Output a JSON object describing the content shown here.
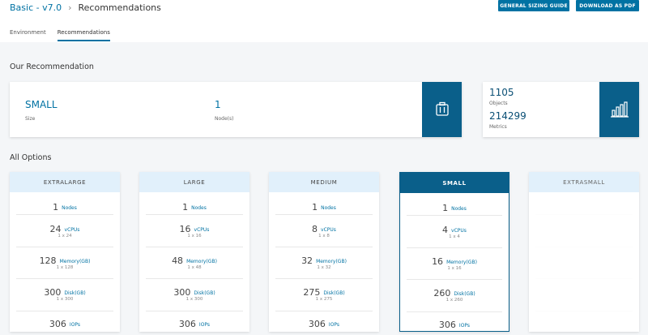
{
  "header": {
    "breadcrumb_root": "Basic - v7.0",
    "breadcrumb_separator": "›",
    "breadcrumb_current": "Recommendations",
    "sizing_guide_button": "GENERAL SIZING GUIDE",
    "download_pdf_button": "DOWNLOAD AS PDF",
    "tabs": [
      {
        "label": "Environment"
      },
      {
        "label": "Recommendations"
      }
    ],
    "active_tab": "Recommendations"
  },
  "recommendation": {
    "title": "Our Recommendation",
    "size_value": "SMALL",
    "size_label": "Size",
    "nodes_value": "1",
    "nodes_label": "Node(s)",
    "icon": "cluster-icon",
    "objects_value": "1105",
    "objects_label": "Objects",
    "metrics_value": "214299",
    "metrics_label": "Metrics",
    "stats_icon": "bar-chart-icon"
  },
  "options": {
    "title": "All Options",
    "selected": "SMALL",
    "cards": [
      {
        "name": "EXTRALARGE",
        "nodes": {
          "value": "1",
          "unit": "Nodes"
        },
        "vcpus": {
          "value": "24",
          "unit": "vCPUs",
          "detail": "1 x 24"
        },
        "memory": {
          "value": "128",
          "unit": "Memory(GB)",
          "detail": "1 x 128"
        },
        "disk": {
          "value": "300",
          "unit": "Disk(GB)",
          "detail": "1 x 300"
        },
        "iops": {
          "value": "306",
          "unit": "IOPs"
        }
      },
      {
        "name": "LARGE",
        "nodes": {
          "value": "1",
          "unit": "Nodes"
        },
        "vcpus": {
          "value": "16",
          "unit": "vCPUs",
          "detail": "1 x 16"
        },
        "memory": {
          "value": "48",
          "unit": "Memory(GB)",
          "detail": "1 x 48"
        },
        "disk": {
          "value": "300",
          "unit": "Disk(GB)",
          "detail": "1 x 300"
        },
        "iops": {
          "value": "306",
          "unit": "IOPs"
        }
      },
      {
        "name": "MEDIUM",
        "nodes": {
          "value": "1",
          "unit": "Nodes"
        },
        "vcpus": {
          "value": "8",
          "unit": "vCPUs",
          "detail": "1 x 8"
        },
        "memory": {
          "value": "32",
          "unit": "Memory(GB)",
          "detail": "1 x 32"
        },
        "disk": {
          "value": "275",
          "unit": "Disk(GB)",
          "detail": "1 x 275"
        },
        "iops": {
          "value": "306",
          "unit": "IOPs"
        }
      },
      {
        "name": "SMALL",
        "nodes": {
          "value": "1",
          "unit": "Nodes"
        },
        "vcpus": {
          "value": "4",
          "unit": "vCPUs",
          "detail": "1 x 4"
        },
        "memory": {
          "value": "16",
          "unit": "Memory(GB)",
          "detail": "1 x 16"
        },
        "disk": {
          "value": "260",
          "unit": "Disk(GB)",
          "detail": "1 x 260"
        },
        "iops": {
          "value": "306",
          "unit": "IOPs"
        }
      },
      {
        "name": "EXTRASMALL",
        "nodes": {
          "value": "",
          "unit": ""
        },
        "vcpus": {
          "value": "",
          "unit": "",
          "detail": ""
        },
        "memory": {
          "value": "",
          "unit": "",
          "detail": ""
        },
        "disk": {
          "value": "",
          "unit": "",
          "detail": ""
        },
        "iops": {
          "value": "",
          "unit": ""
        }
      }
    ]
  },
  "colors": {
    "accent": "#0072a3",
    "dark_accent": "#0a5f8a",
    "card_header": "#e1f0fb"
  }
}
